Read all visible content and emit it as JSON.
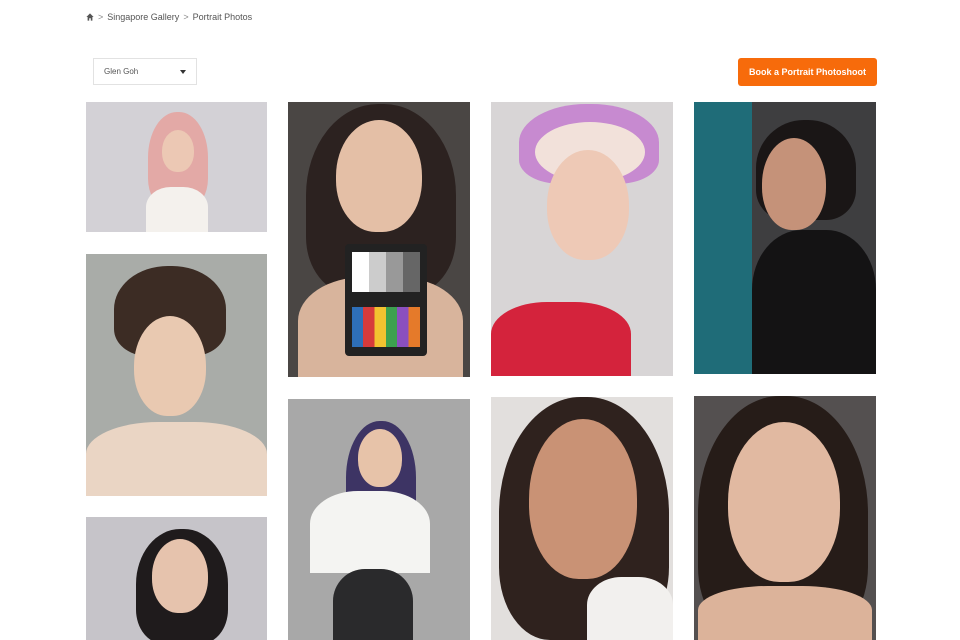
{
  "breadcrumb": {
    "home_icon": "home-icon",
    "items": [
      "Singapore Gallery",
      "Portrait Photos"
    ],
    "separator": ">"
  },
  "filter": {
    "selected": "Glen Goh",
    "icon": "caret-down-icon"
  },
  "cta": {
    "label": "Book a Portrait Photoshoot",
    "color": "#f76b0b"
  },
  "gallery": {
    "photos": [
      {
        "name": "pink-hair-portrait",
        "bg": "#d3d1d6"
      },
      {
        "name": "bridal-updo-portrait",
        "bg": "#a9aca8"
      },
      {
        "name": "curly-dark-hair-portrait",
        "bg": "#c6c4c9"
      },
      {
        "name": "color-checker-portrait",
        "bg": "#4a4644"
      },
      {
        "name": "purple-hair-portrait",
        "bg": "#a8a8a8"
      },
      {
        "name": "floral-headpiece-portrait",
        "bg": "#d8d5d6"
      },
      {
        "name": "natural-closeup-portrait",
        "bg": "#e2dfdd"
      },
      {
        "name": "teal-curtain-portrait",
        "bg": "#3e3e40"
      },
      {
        "name": "smiling-closeup-portrait",
        "bg": "#545050"
      }
    ]
  }
}
